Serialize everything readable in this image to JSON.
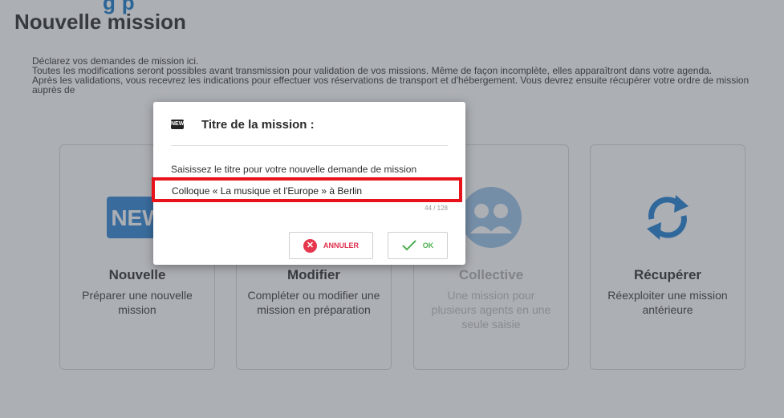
{
  "header": {
    "fragment": "g      p",
    "title": "Nouvelle mission"
  },
  "intro": {
    "line1": "Déclarez vos demandes de mission ici.",
    "line2": "Toutes les modifications seront possibles avant transmission pour validation de vos missions. Même de façon incomplète, elles apparaîtront dans votre agenda.",
    "line3": "Après les validations, vous recevrez les indications pour effectuer vos réservations de transport et d'hébergement. Vous devrez ensuite récupérer votre ordre de mission auprès de"
  },
  "cards": [
    {
      "icon": "new-badge-icon",
      "title": "Nouvelle",
      "desc": "Préparer une nouvelle mission",
      "color": "#2f86d6"
    },
    {
      "icon": "edit-icon",
      "title": "Modifier",
      "desc": "Compléter ou modifier une mission en préparation"
    },
    {
      "icon": "group-icon",
      "title": "Collective",
      "desc": "Une mission pour plusieurs agents en une seule saisie",
      "color": "#1e7fd2"
    },
    {
      "icon": "sync-icon",
      "title": "Récupérer",
      "desc": "Réexploiter une mission antérieure",
      "color": "#1e7fd2"
    }
  ],
  "dialog": {
    "badge": "NEW",
    "title": "Titre de la mission :",
    "field_label": "Saisissez le titre pour votre nouvelle demande de mission",
    "field_value": "Colloque « La musique et l'Europe » à Berlin",
    "char_count": "44 / 128",
    "cancel_label": "ANNULER",
    "ok_label": "OK"
  },
  "colors": {
    "overlay": "rgba(70,78,88,0.45)",
    "highlight": "#e8121a",
    "cancel": "#e0314e",
    "ok": "#4caf50"
  }
}
